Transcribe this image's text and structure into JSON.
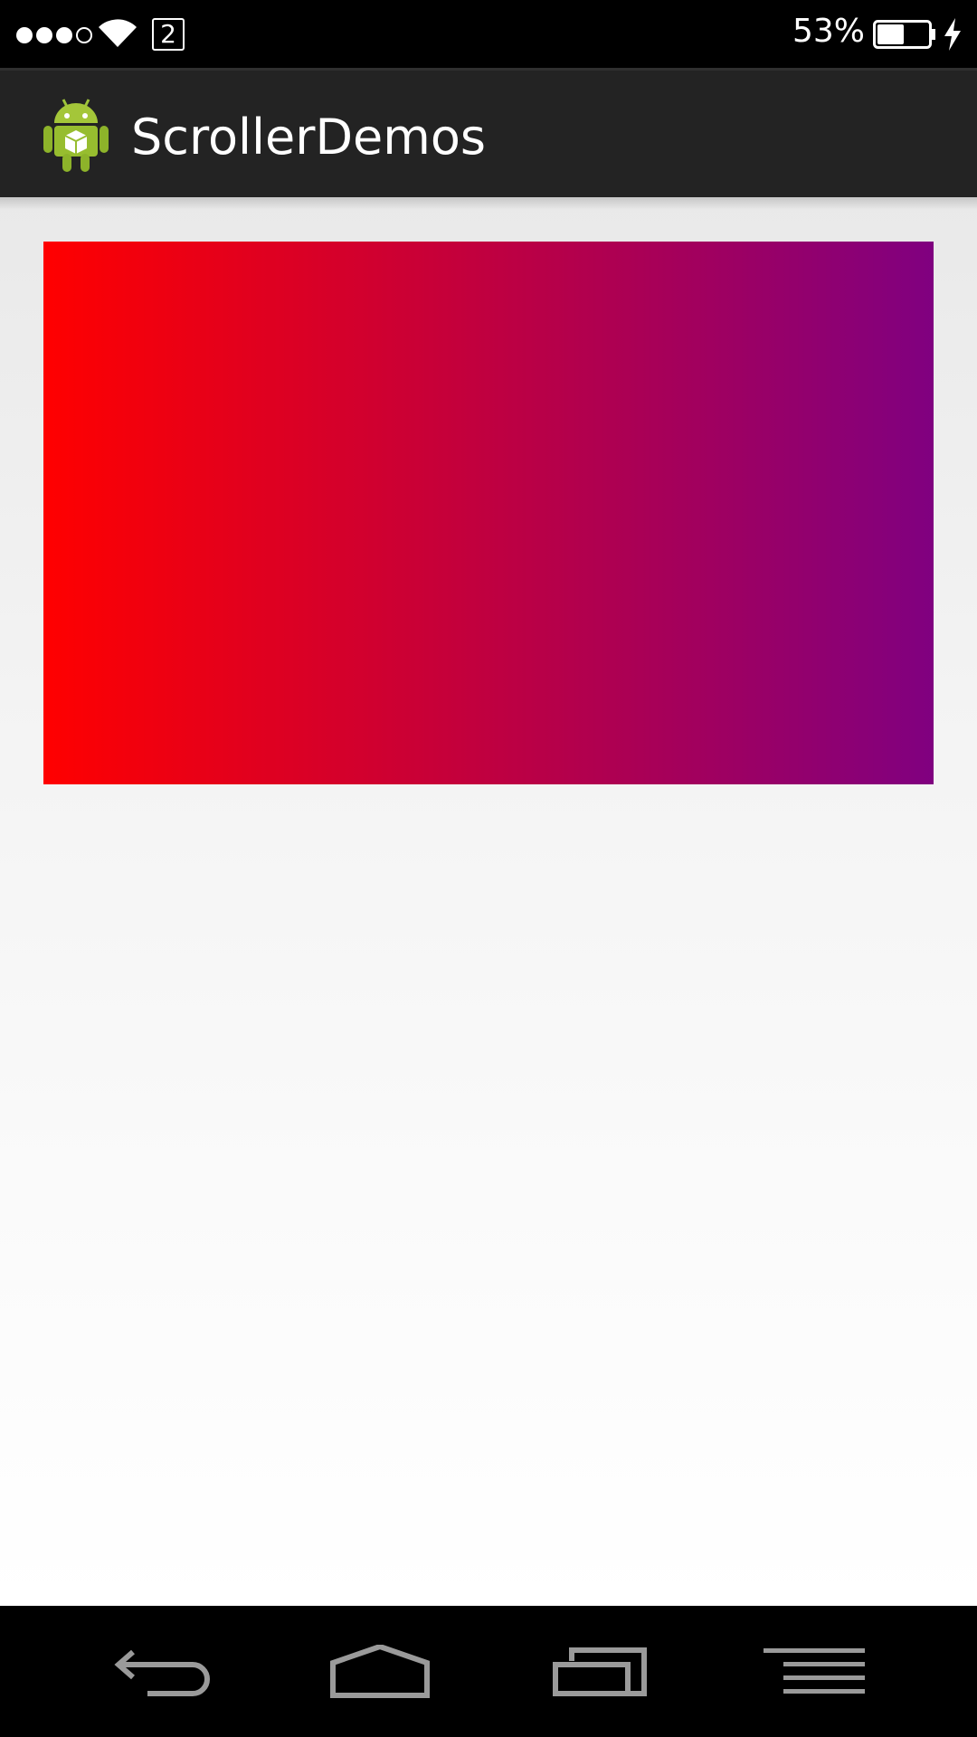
{
  "status_bar": {
    "signal_bars_filled": 3,
    "signal_bars_total": 4,
    "sim_number": "2",
    "battery_percent": "53%",
    "battery_level": 0.53,
    "charging": true,
    "wifi_icon": "wifi-icon",
    "battery_icon": "battery-icon",
    "charging_icon": "charging-bolt-icon"
  },
  "action_bar": {
    "app_icon": "android-robot-icon",
    "title": "ScrollerDemos"
  },
  "content": {
    "gradient_view": {
      "start_color": "#ff0000",
      "end_color": "#800080"
    }
  },
  "nav_bar": {
    "buttons": [
      {
        "icon": "back-icon"
      },
      {
        "icon": "home-icon"
      },
      {
        "icon": "recent-apps-icon"
      },
      {
        "icon": "menu-icon"
      }
    ]
  },
  "colors": {
    "status_bar_bg": "#000000",
    "action_bar_bg": "#232323",
    "nav_icon": "#9a9a9a"
  }
}
